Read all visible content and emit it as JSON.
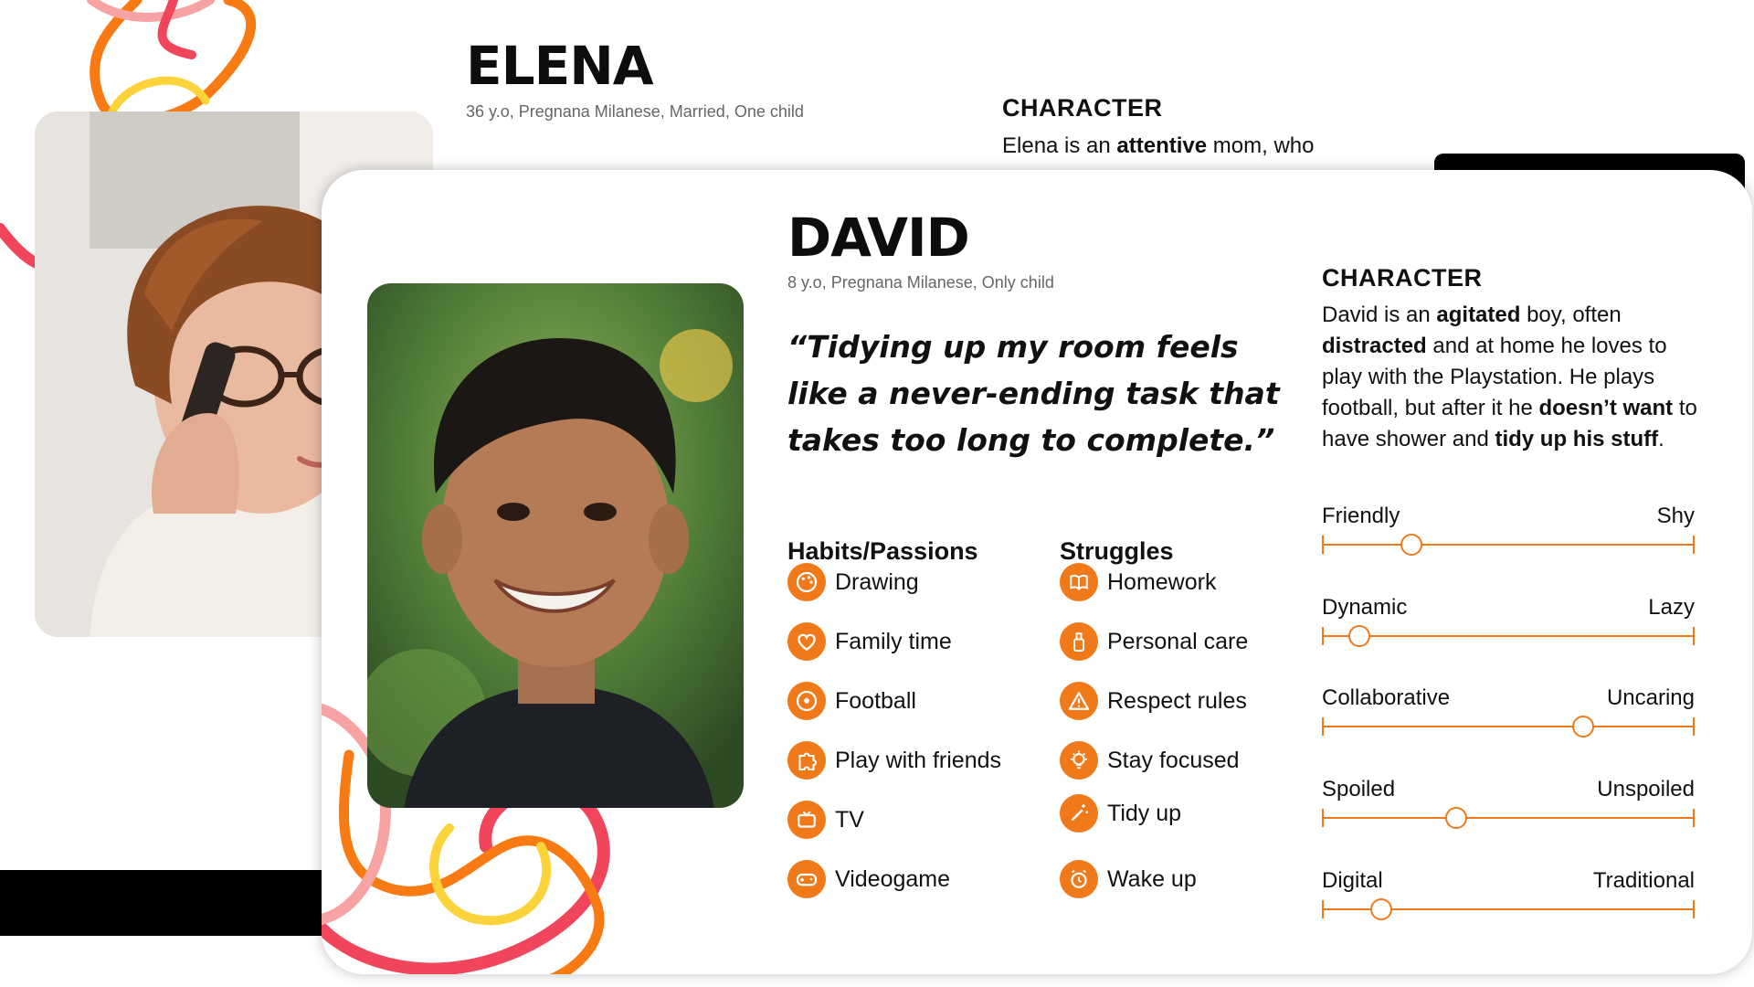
{
  "elena": {
    "name": "ELENA",
    "subtitle": "36 y.o, Pregnana Milanese, Married, One child",
    "character_heading": "CHARACTER",
    "character_pre": "Elena is an ",
    "character_bold": "attentive",
    "character_post": " mom, who"
  },
  "david": {
    "name": "DAVID",
    "subtitle": "8 y.o, Pregnana Milanese, Only child",
    "quote": "“Tidying up my room feels like a never-ending task that takes too long to complete.”",
    "character_heading": "CHARACTER",
    "character_parts": [
      {
        "t": "David is an ",
        "b": false
      },
      {
        "t": "agitated",
        "b": true
      },
      {
        "t": " boy, often ",
        "b": false
      },
      {
        "t": "distracted",
        "b": true
      },
      {
        "t": " and at home he loves to play with the Playstation. He plays football, but after it he ",
        "b": false
      },
      {
        "t": "doesn’t want",
        "b": true
      },
      {
        "t": " to have shower and ",
        "b": false
      },
      {
        "t": "tidy up his stuff",
        "b": true
      },
      {
        "t": ".",
        "b": false
      }
    ],
    "habits_title": "Habits/Passions",
    "habits": [
      {
        "label": "Drawing",
        "icon": "palette-icon"
      },
      {
        "label": "Family time",
        "icon": "heart-icon"
      },
      {
        "label": "Football",
        "icon": "soccer-ball-icon"
      },
      {
        "label": "Play with friends",
        "icon": "puzzle-icon"
      },
      {
        "label": "TV",
        "icon": "tv-icon"
      },
      {
        "label": "Videogame",
        "icon": "gamepad-icon"
      }
    ],
    "struggles_title": "Struggles",
    "struggles": [
      {
        "label": "Homework",
        "icon": "book-icon"
      },
      {
        "label": "Personal care",
        "icon": "spray-bottle-icon"
      },
      {
        "label": "Respect rules",
        "icon": "warning-icon"
      },
      {
        "label": "Stay focused",
        "icon": "lightbulb-icon"
      },
      {
        "label": "Tidy up",
        "icon": "magic-wand-icon"
      },
      {
        "label": "Wake up",
        "icon": "alarm-clock-icon"
      }
    ],
    "traits": [
      {
        "left": "Friendly",
        "right": "Shy",
        "value": 0.24
      },
      {
        "left": "Dynamic",
        "right": "Lazy",
        "value": 0.1
      },
      {
        "left": "Collaborative",
        "right": "Uncaring",
        "value": 0.7
      },
      {
        "left": "Spoiled",
        "right": "Unspoiled",
        "value": 0.36
      },
      {
        "left": "Digital",
        "right": "Traditional",
        "value": 0.16
      }
    ]
  },
  "colors": {
    "accent": "#f07a1a",
    "squiggle_red": "#f0455a",
    "squiggle_orange": "#f77a12",
    "squiggle_yellow": "#fcd33a",
    "squiggle_pink": "#f7a3a3"
  }
}
